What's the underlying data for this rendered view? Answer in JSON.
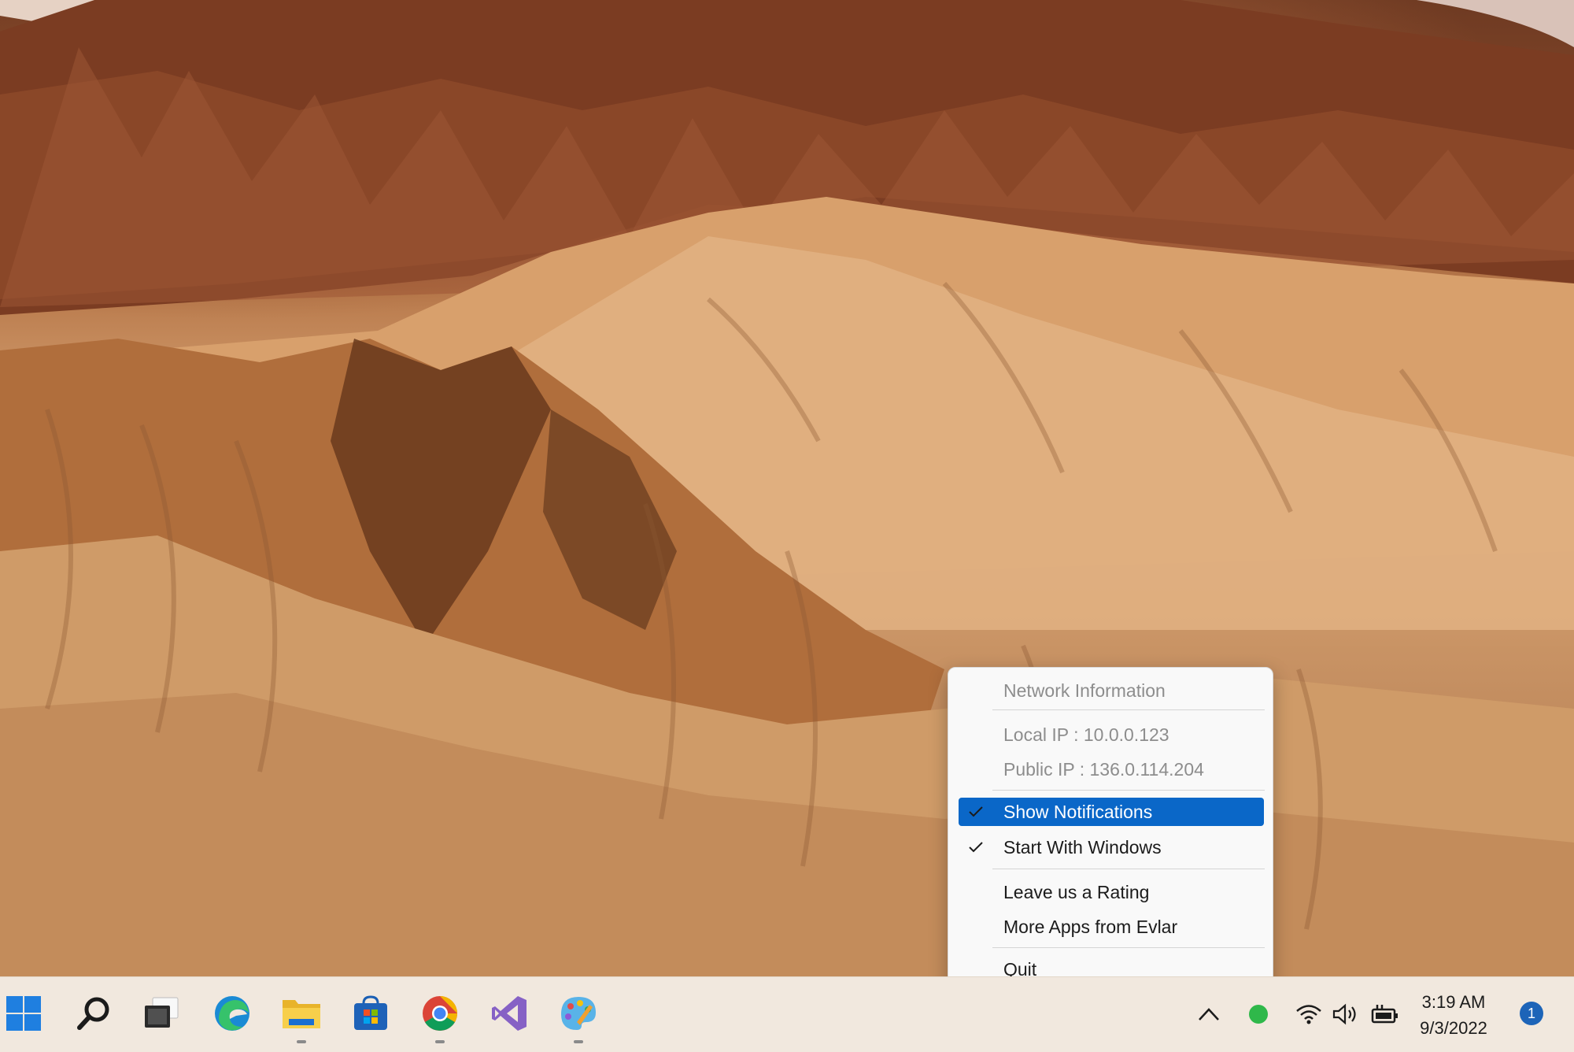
{
  "menu": {
    "header": "Network Information",
    "local_ip": "Local IP : 10.0.0.123",
    "public_ip": "Public IP : 136.0.114.204",
    "show_notifications": "Show Notifications",
    "show_notifications_checked": true,
    "start_with_windows": "Start With Windows",
    "start_with_windows_checked": true,
    "leave_rating": "Leave us a Rating",
    "more_apps": "More Apps from Evlar",
    "quit": "Quit"
  },
  "taskbar": {
    "apps": [
      {
        "name": "start",
        "running": false
      },
      {
        "name": "search",
        "running": false
      },
      {
        "name": "task-view",
        "running": false
      },
      {
        "name": "edge",
        "running": false
      },
      {
        "name": "file-explorer",
        "running": true
      },
      {
        "name": "microsoft-store",
        "running": false
      },
      {
        "name": "chrome",
        "running": true
      },
      {
        "name": "visual-studio",
        "running": false
      },
      {
        "name": "paint",
        "running": true
      }
    ],
    "tray": {
      "status_color": "#2fb84a",
      "time": "3:19 AM",
      "date": "9/3/2022",
      "notification_count": "1"
    }
  },
  "colors": {
    "accent": "#0a67c8",
    "taskbar": "#f1e8de"
  }
}
